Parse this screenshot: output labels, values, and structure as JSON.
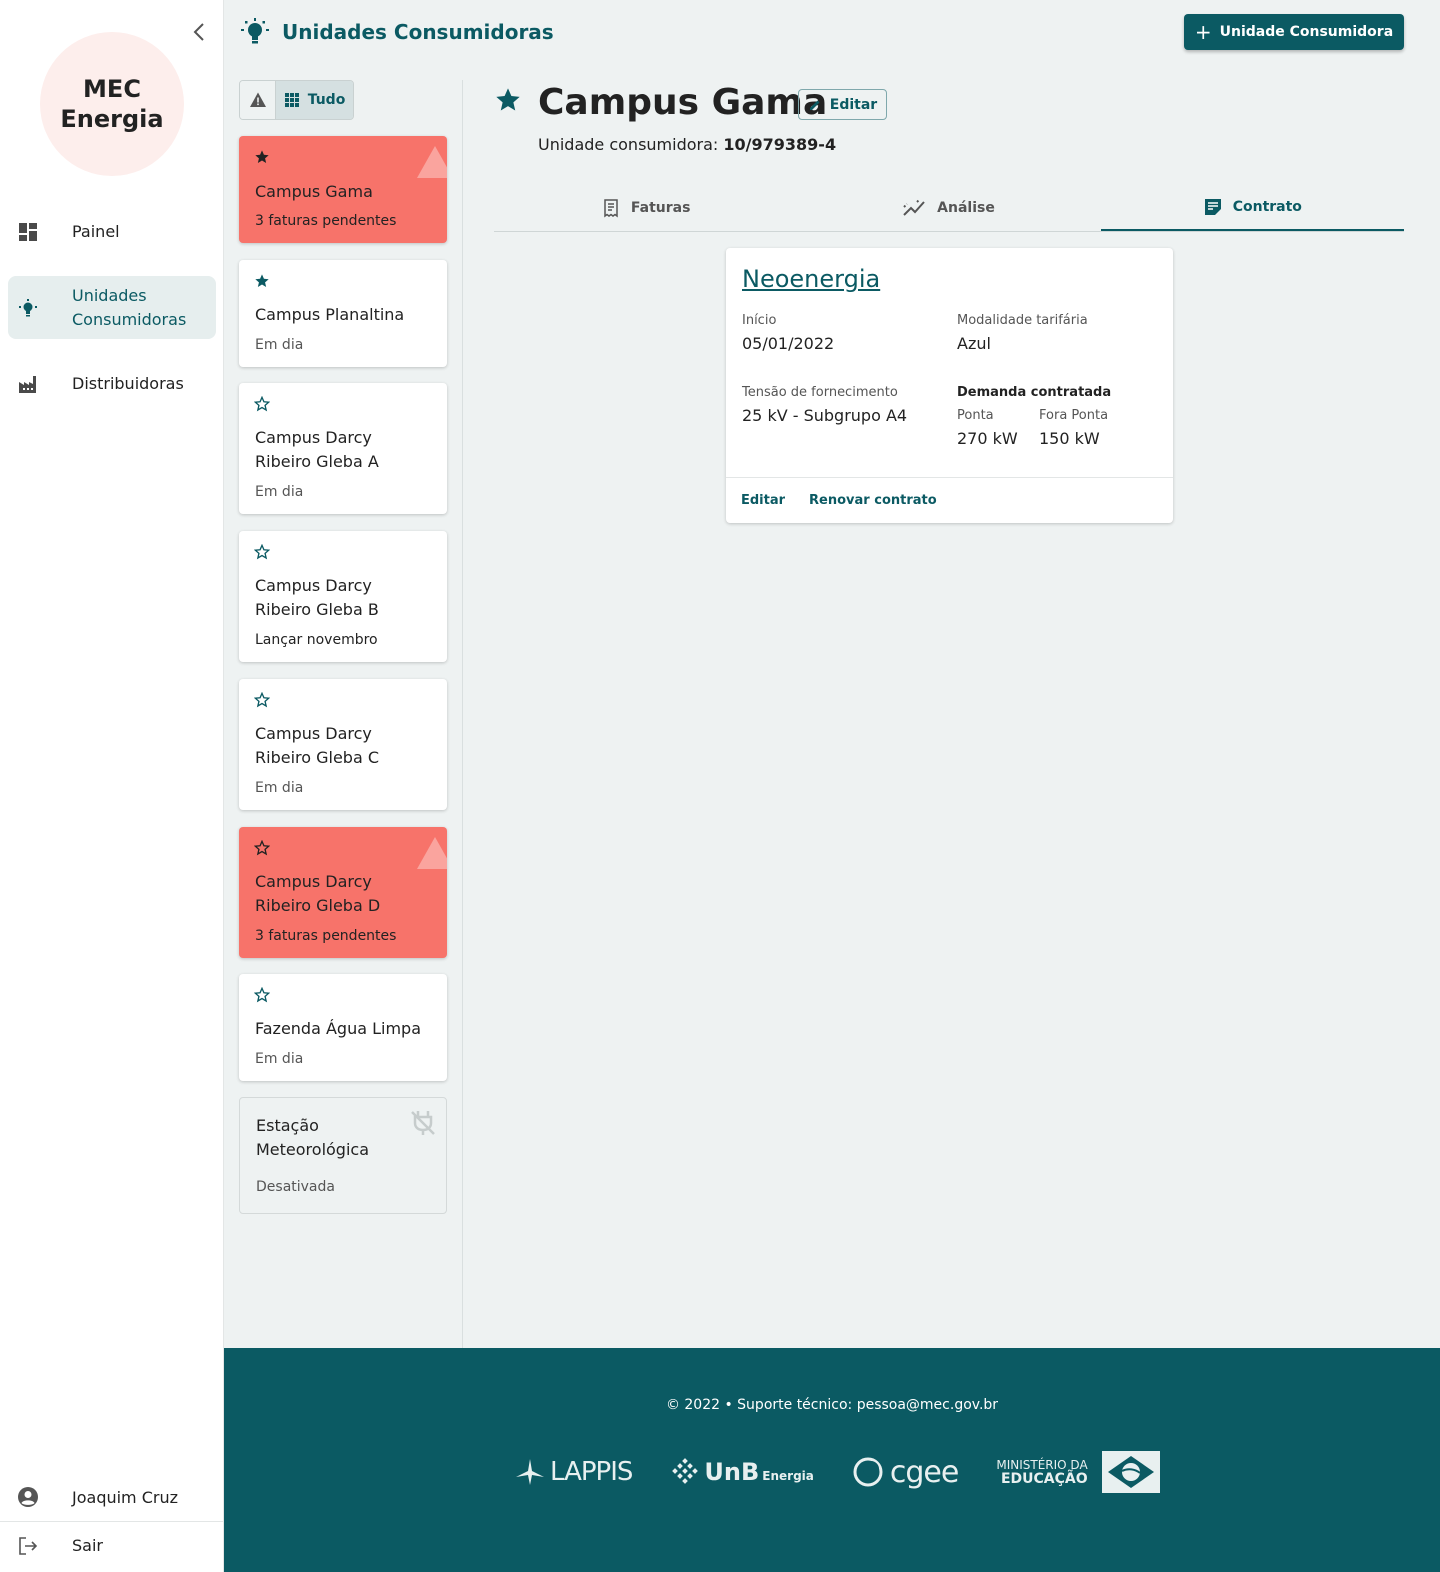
{
  "sidebar": {
    "logo": {
      "line1": "MEC",
      "line2": "Energia"
    },
    "nav": [
      {
        "label": "Painel",
        "icon": "dashboard-icon"
      },
      {
        "label": "Unidades Consumidoras",
        "icon": "lightbulb-icon",
        "active": true
      },
      {
        "label": "Distribuidoras",
        "icon": "factory-icon"
      }
    ],
    "user": {
      "name": "Joaquim Cruz"
    },
    "logout_label": "Sair"
  },
  "header": {
    "title": "Unidades Consumidoras",
    "add_button_label": "Unidade Consumidora"
  },
  "filter": {
    "all_label": "Tudo"
  },
  "units": [
    {
      "name": "Campus Gama",
      "status": "3 faturas pendentes",
      "favorite": true,
      "alert": true
    },
    {
      "name": "Campus Planaltina",
      "status": "Em dia",
      "favorite": true
    },
    {
      "name": "Campus Darcy Ribeiro Gleba A",
      "status": "Em dia",
      "favorite": false
    },
    {
      "name": "Campus Darcy Ribeiro Gleba B",
      "status": "Lançar novembro",
      "favorite": false
    },
    {
      "name": "Campus Darcy Ribeiro Gleba C",
      "status": "Em dia",
      "favorite": false
    },
    {
      "name": "Campus Darcy Ribeiro Gleba D",
      "status": "3 faturas pendentes",
      "favorite": false,
      "alert": true
    },
    {
      "name": "Fazenda Água Limpa",
      "status": "Em dia",
      "favorite": false
    },
    {
      "name": "Estação Meteorológica",
      "status": "Desativada",
      "disabled": true
    }
  ],
  "detail": {
    "title": "Campus Gama",
    "edit_label": "Editar",
    "uc_label": "Unidade consumidora:",
    "uc_number": "10/979389-4",
    "tabs": [
      {
        "label": "Faturas",
        "icon": "receipt-icon"
      },
      {
        "label": "Análise",
        "icon": "chart-line-icon"
      },
      {
        "label": "Contrato",
        "icon": "contract-icon",
        "active": true
      }
    ],
    "contract": {
      "distributor": "Neoenergia",
      "start_label": "Início",
      "start_value": "05/01/2022",
      "modality_label": "Modalidade tarifária",
      "modality_value": "Azul",
      "voltage_label": "Tensão de fornecimento",
      "voltage_value": "25 kV - Subgrupo A4",
      "demand_label": "Demanda contratada",
      "peak_label": "Ponta",
      "peak_value": "270 kW",
      "offpeak_label": "Fora Ponta",
      "offpeak_value": "150 kW",
      "edit_action": "Editar",
      "renew_action": "Renovar contrato"
    }
  },
  "footer": {
    "copyright": "© 2022  •  Suporte técnico: pessoa@mec.gov.br",
    "logos": {
      "lappis": "LAPPIS",
      "unb": "UnB",
      "unb_sub": "Energia",
      "cgee": "cgee",
      "mec_line1": "MINISTÉRIO DA",
      "mec_line2": "EDUCAÇÃO"
    }
  },
  "colors": {
    "primary": "#0b5a63",
    "alert": "#f7736a",
    "logo_bg": "#fdeeec"
  }
}
